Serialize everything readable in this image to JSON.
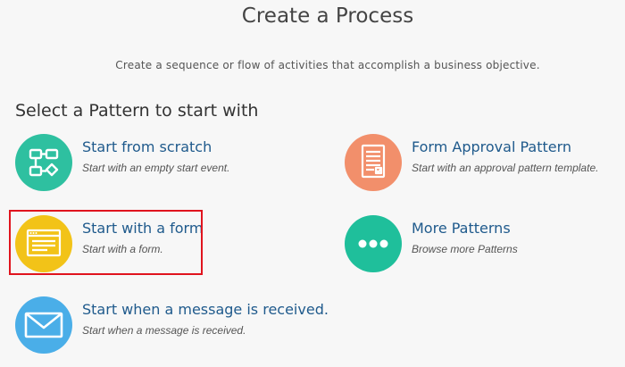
{
  "page": {
    "title": "Create a Process",
    "subtitle": "Create a sequence or flow of activities that accomplish a business objective."
  },
  "section": {
    "heading": "Select a Pattern to start with"
  },
  "options": [
    {
      "id": "scratch",
      "title": "Start from scratch",
      "description": "Start with an empty start event.",
      "icon": "flowchart-icon",
      "color": "#2ec0a0"
    },
    {
      "id": "approval",
      "title": "Form Approval Pattern",
      "description": "Start with an approval pattern template.",
      "icon": "document-checklist-icon",
      "color": "#f28f6b"
    },
    {
      "id": "form",
      "title": "Start with a form",
      "description": "Start with a form.",
      "icon": "form-window-icon",
      "color": "#f2c318"
    },
    {
      "id": "more",
      "title": "More Patterns",
      "description": "Browse more Patterns",
      "icon": "ellipsis-icon",
      "color": "#1fbf9b"
    },
    {
      "id": "message",
      "title": "Start when a message is received.",
      "description": "Start when a message is received.",
      "icon": "envelope-icon",
      "color": "#4aaee8"
    }
  ],
  "highlight": {
    "color": "#e0141e",
    "target": "form"
  }
}
